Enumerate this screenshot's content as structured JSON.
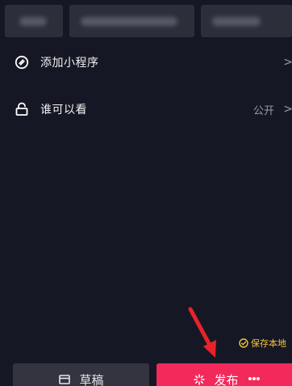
{
  "settings": {
    "mini_program": {
      "label": "添加小程序",
      "chevron": ">"
    },
    "visibility": {
      "label": "谁可以看",
      "value": "公开",
      "chevron": ">"
    }
  },
  "save_local": {
    "label": "保存本地"
  },
  "actions": {
    "draft_label": "草稿",
    "publish_label": "发布"
  },
  "colors": {
    "background": "#161724",
    "publish_button": "#f2295a",
    "draft_button": "#33343f",
    "save_local_accent": "#f2c63a",
    "annotation_arrow": "#e8222a"
  }
}
